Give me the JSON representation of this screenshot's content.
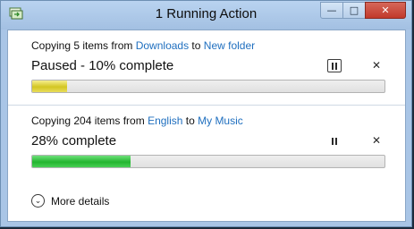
{
  "window": {
    "title": "1 Running Action",
    "minimize_glyph": "—",
    "maximize_glyph": "□",
    "close_glyph": "✕"
  },
  "tasks": [
    {
      "prefix": "Copying 5 items from ",
      "source": "Downloads",
      "connector": " to ",
      "destination": "New folder",
      "status": "Paused - 10% complete",
      "progress_fraction": 0.1,
      "state": "paused",
      "cancel_glyph": "✕"
    },
    {
      "prefix": "Copying 204 items from ",
      "source": "English",
      "connector": " to ",
      "destination": "My Music",
      "status": "28% complete",
      "progress_fraction": 0.28,
      "state": "running",
      "cancel_glyph": "✕"
    }
  ],
  "footer": {
    "details_label": "More details",
    "chevron_glyph": "⌄"
  },
  "colors": {
    "link": "#1f6fbf",
    "paused_fill": "#d3c622",
    "running_fill": "#23b52f",
    "window_frame": "#a9c5e6"
  },
  "icons": {
    "app": "copy-progress-icon",
    "pause": "pause-icon",
    "cancel": "close-icon",
    "expand": "chevron-down-icon"
  }
}
